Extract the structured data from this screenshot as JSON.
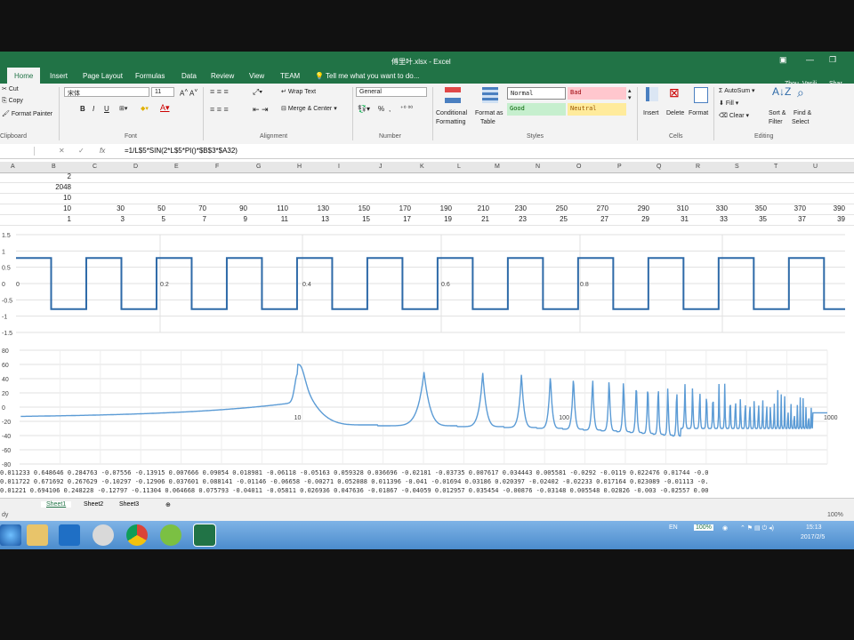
{
  "window": {
    "title": "傅里叶.xlsx - Excel",
    "user": "Zhou, Vasili",
    "share": "Shar"
  },
  "tabs": [
    "Home",
    "Insert",
    "Page Layout",
    "Formulas",
    "Data",
    "Review",
    "View",
    "TEAM"
  ],
  "tell_me": "Tell me what you want to do...",
  "ribbon": {
    "clipboard": {
      "cut": "Cut",
      "copy": "Copy",
      "format_painter": "Format Painter",
      "group": "Clipboard"
    },
    "font": {
      "name": "宋体",
      "size": "11",
      "bold": "B",
      "italic": "I",
      "underline": "U",
      "group": "Font"
    },
    "alignment": {
      "wrap": "Wrap Text",
      "merge": "Merge & Center",
      "group": "Alignment"
    },
    "number": {
      "format": "General",
      "percent": "%",
      "comma": ",",
      "group": "Number"
    },
    "styles": {
      "conditional": "Conditional",
      "conditional2": "Formatting",
      "format_as": "Format as",
      "format_as2": "Table",
      "normal": "Normal",
      "bad": "Bad",
      "good": "Good",
      "neutral": "Neutral",
      "group": "Styles"
    },
    "cells": {
      "insert": "Insert",
      "delete": "Delete",
      "format": "Format",
      "group": "Cells"
    },
    "editing": {
      "autosum": "AutoSum",
      "fill": "Fill",
      "clear": "Clear",
      "sort": "Sort &",
      "sort2": "Filter",
      "find": "Find &",
      "find2": "Select",
      "group": "Editing"
    }
  },
  "formula": "=1/L$5*SIN(2*L$5*PI()*$B$3*$A32)",
  "columns": [
    "A",
    "B",
    "C",
    "D",
    "E",
    "F",
    "G",
    "H",
    "I",
    "J",
    "K",
    "L",
    "M",
    "N",
    "O",
    "P",
    "Q",
    "R",
    "S",
    "T",
    "U"
  ],
  "b_values": [
    "2",
    "2048",
    "10",
    "10",
    "1"
  ],
  "row_freq": [
    "30",
    "50",
    "70",
    "90",
    "110",
    "130",
    "150",
    "170",
    "190",
    "210",
    "230",
    "250",
    "270",
    "290",
    "310",
    "330",
    "350",
    "370",
    "390"
  ],
  "row_harm": [
    "3",
    "5",
    "7",
    "9",
    "11",
    "13",
    "15",
    "17",
    "19",
    "21",
    "23",
    "25",
    "27",
    "29",
    "31",
    "33",
    "35",
    "37",
    "39"
  ],
  "chart_data": [
    {
      "type": "line",
      "title": "",
      "ylim": [
        -1.5,
        1.5
      ],
      "yticks": [
        "1.5",
        "1",
        "0.5",
        "0",
        "-0.5",
        "-1",
        "-1.5"
      ],
      "xticks": [
        "0",
        "0.2",
        "0.4",
        "0.6",
        "0.8"
      ],
      "series": [
        {
          "values_description": "square wave",
          "frequency": 10,
          "amplitude": 0.785,
          "color": "#2e6aa8"
        }
      ]
    },
    {
      "type": "line",
      "title": "",
      "ylim": [
        -80,
        80
      ],
      "yticks": [
        "80",
        "60",
        "40",
        "20",
        "0",
        "-20",
        "-40",
        "-60",
        "-80"
      ],
      "xticks": [
        "10",
        "100",
        "1000"
      ],
      "series": [
        {
          "color": "#5b9bd5"
        }
      ]
    }
  ],
  "bottom_rows": [
    "0.011233 0.648646 0.284763 -0.07556 -0.13915 0.007666  0.09054 0.018981 -0.06118 -0.05163 0.059328 0.036696 -0.02181 -0.03735 0.007617  0.034443 0.005581 -0.0292  -0.0119 0.022476  0.01744 -0.0",
    "0.011722 0.671692 0.267629 -0.10297 -0.12906 0.037601 0.088141 -0.01146 -0.06658 -0.00271 0.052088 0.011396  -0.041 -0.01694  0.03186 0.020397 -0.02402 -0.02233 0.017164 0.023089 -0.01113 -0.",
    "0.01221 0.694106 0.248228 -0.12797 -0.11304 0.064668 0.075793 -0.04011 -0.05811 0.026936 0.047636 -0.01867 -0.04059 0.012957 0.035454 -0.00876 -0.03148 0.005548  0.02826   -0.003 -0.02557 0.00"
  ],
  "sheets": [
    "Sheet1",
    "Sheet2",
    "Sheet3"
  ],
  "status": {
    "ready": "dy",
    "zoom": "100%"
  },
  "taskbar": {
    "lang": "EN",
    "battery": "100%",
    "time": "15:13",
    "date": "2017/2/5"
  }
}
